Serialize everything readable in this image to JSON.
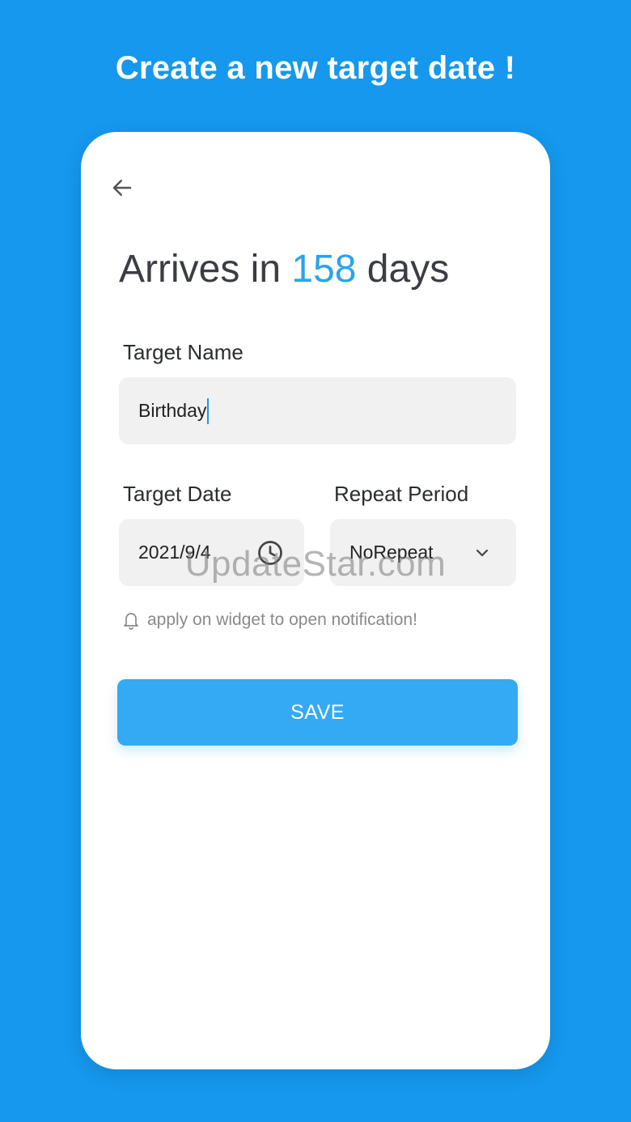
{
  "promo": {
    "title": "Create a new target date !"
  },
  "header": {
    "back_icon": "arrow-left-icon",
    "heading_prefix": "Arrives in ",
    "days_count": "158",
    "heading_suffix": " days"
  },
  "form": {
    "target_name": {
      "label": "Target Name",
      "value": "Birthday"
    },
    "target_date": {
      "label": "Target Date",
      "value": "2021/9/4",
      "icon": "clock-icon"
    },
    "repeat_period": {
      "label": "Repeat Period",
      "selected": "NoRepeat",
      "icon": "chevron-down-icon"
    },
    "hint": {
      "icon": "bell-icon",
      "text": "apply on widget to open notification!"
    },
    "save_label": "SAVE"
  },
  "watermark": "UpdateStar.com",
  "colors": {
    "background": "#1598ee",
    "accent": "#2aa3ec",
    "button": "#34aaf4",
    "card": "#ffffff"
  }
}
